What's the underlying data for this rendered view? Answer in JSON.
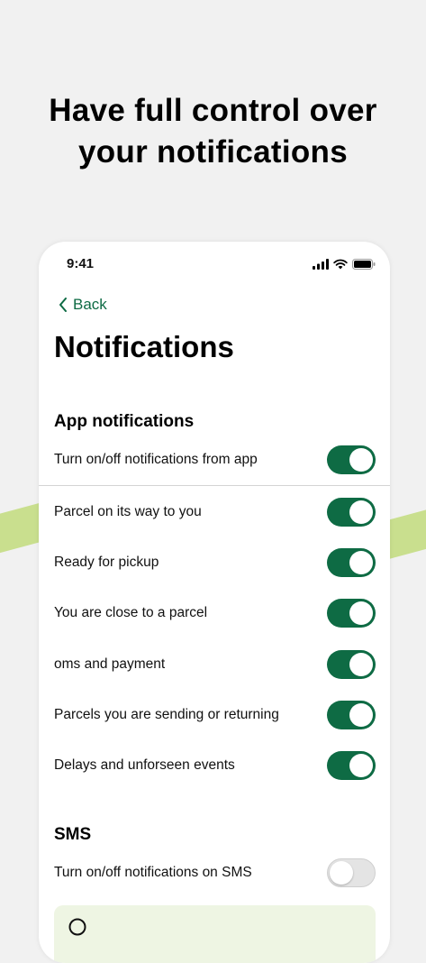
{
  "headline": {
    "line1": "Have full control over",
    "line2": "your notifications"
  },
  "status_bar": {
    "time": "9:41"
  },
  "nav": {
    "back_label": "Back"
  },
  "page_title": "Notifications",
  "app_notifications": {
    "title": "App notifications",
    "master": {
      "label": "Turn on/off notifications from app",
      "on": true
    },
    "items": [
      {
        "label": "Parcel on its way to you",
        "on": true
      },
      {
        "label": "Ready for pickup",
        "on": true
      },
      {
        "label": "You are close to a parcel",
        "on": true
      },
      {
        "label": "oms and payment",
        "on": true
      },
      {
        "label": "Parcels you are sending or returning",
        "on": true
      },
      {
        "label": "Delays and unforseen events",
        "on": true
      }
    ]
  },
  "sms": {
    "title": "SMS",
    "master": {
      "label": "Turn on/off notifications on SMS",
      "on": false
    }
  },
  "colors": {
    "accent_green": "#0e6b44",
    "stripe": "#c9df8e",
    "info_box": "#eef5e3"
  }
}
